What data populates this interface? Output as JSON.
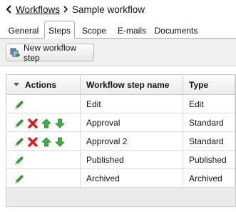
{
  "breadcrumb": {
    "parent": "Workflows",
    "current": "Sample workflow"
  },
  "tabs": [
    {
      "label": "General"
    },
    {
      "label": "Steps",
      "active": true
    },
    {
      "label": "Scope"
    },
    {
      "label": "E-mails"
    },
    {
      "label": "Documents"
    }
  ],
  "toolbar": {
    "new_step_label": "New workflow step"
  },
  "grid": {
    "headers": {
      "actions": "Actions",
      "name": "Workflow step name",
      "type": "Type"
    },
    "rows": [
      {
        "name": "Edit",
        "type": "Edit",
        "actions": [
          "edit"
        ]
      },
      {
        "name": "Approval",
        "type": "Standard",
        "actions": [
          "edit",
          "delete",
          "move-up",
          "move-down"
        ]
      },
      {
        "name": "Approval 2",
        "type": "Standard",
        "actions": [
          "edit",
          "delete",
          "move-up",
          "move-down"
        ]
      },
      {
        "name": "Published",
        "type": "Published",
        "actions": [
          "edit"
        ]
      },
      {
        "name": "Archived",
        "type": "Archived",
        "actions": [
          "edit"
        ]
      }
    ]
  },
  "colors": {
    "edit_icon": "#3aa23a",
    "delete_icon": "#d81c1c",
    "move_icon": "#3bb53b"
  }
}
